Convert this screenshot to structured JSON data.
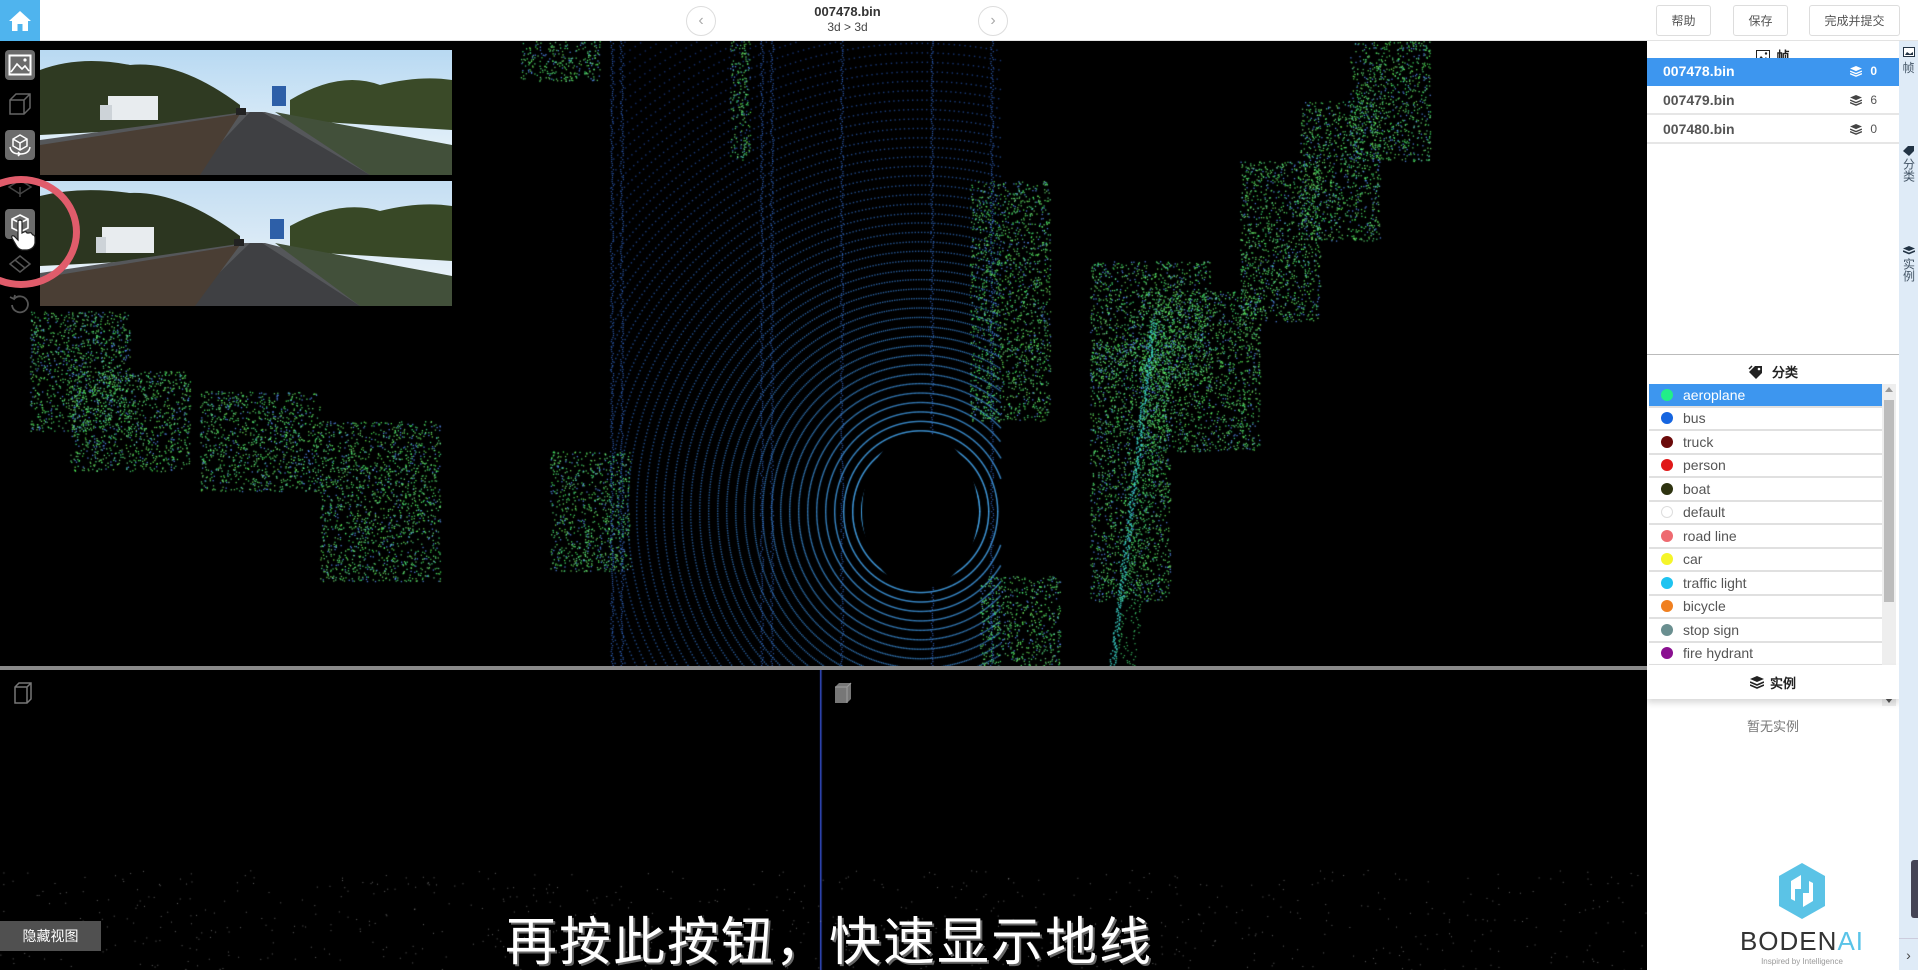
{
  "topbar": {
    "file_title": "007478.bin",
    "breadcrumb": "3d > 3d",
    "prev_label": "‹",
    "next_label": "›",
    "help_label": "帮助",
    "save_label": "保存",
    "submit_label": "完成并提交"
  },
  "toolbar": {
    "tools": [
      {
        "name": "image-view-tool",
        "active": true
      },
      {
        "name": "cube-tool",
        "active": false
      },
      {
        "name": "rotate-cube-tool",
        "active": true
      },
      {
        "name": "ground-tool",
        "active": false
      },
      {
        "name": "box-tool",
        "active": true
      },
      {
        "name": "plane-tool",
        "active": false
      },
      {
        "name": "reset-tool",
        "active": false
      }
    ]
  },
  "bottom": {
    "hide_view_label": "隐藏视图",
    "subtitle": "再按此按钮，快速显示地线"
  },
  "frames": {
    "header": "帧",
    "items": [
      {
        "name": "007478.bin",
        "count": "0",
        "active": true
      },
      {
        "name": "007479.bin",
        "count": "6",
        "active": false
      },
      {
        "name": "007480.bin",
        "count": "0",
        "active": false
      }
    ]
  },
  "classes": {
    "header": "分类",
    "items": [
      {
        "label": "aeroplane",
        "color": "#22ee88",
        "active": true
      },
      {
        "label": "bus",
        "color": "#1565e0",
        "active": false
      },
      {
        "label": "truck",
        "color": "#6b0a0a",
        "active": false
      },
      {
        "label": "person",
        "color": "#e01818",
        "active": false
      },
      {
        "label": "boat",
        "color": "#2e3310",
        "active": false
      },
      {
        "label": "default",
        "color": "#ffffff",
        "active": false
      },
      {
        "label": "road line",
        "color": "#ee6a70",
        "active": false
      },
      {
        "label": "car",
        "color": "#f5f52a",
        "active": false
      },
      {
        "label": "traffic light",
        "color": "#1ec3f0",
        "active": false
      },
      {
        "label": "bicycle",
        "color": "#f08020",
        "active": false
      },
      {
        "label": "stop sign",
        "color": "#6a8f90",
        "active": false
      },
      {
        "label": "fire hydrant",
        "color": "#8a1090",
        "active": false
      }
    ]
  },
  "instances": {
    "header": "实例",
    "empty_text": "暂无实例"
  },
  "side_tabs": {
    "frames": "帧",
    "classes": "分类",
    "instances": "实例"
  },
  "logo": {
    "name_main": "BODEN",
    "name_accent": "AI",
    "tagline": "Inspired by Intelligence"
  },
  "colors": {
    "accent": "#3d96ef",
    "home": "#4fb4ee",
    "ring": "#e05c6b"
  }
}
